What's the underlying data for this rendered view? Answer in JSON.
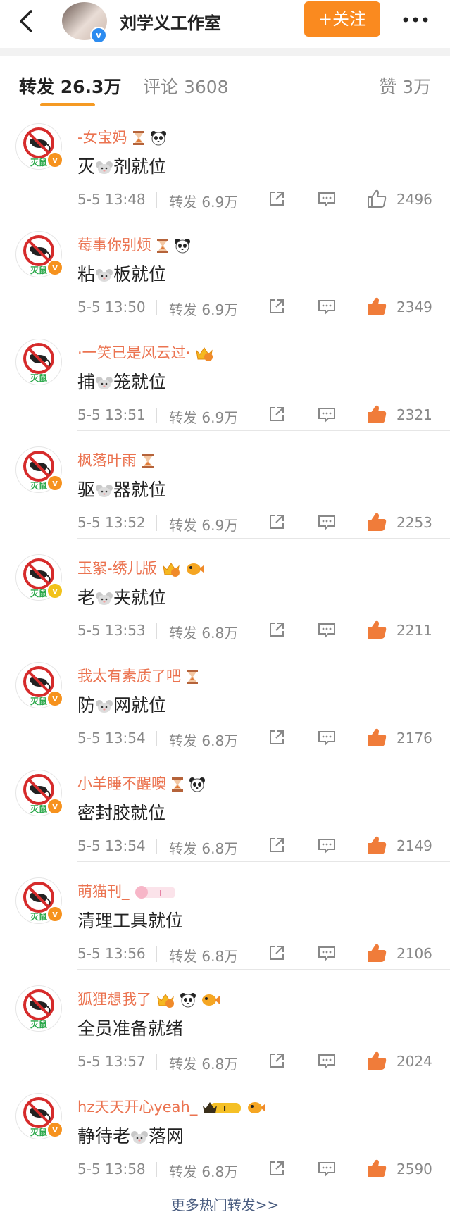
{
  "header": {
    "back_icon": "back-arrow-icon",
    "account_name": "刘学义工作室",
    "verified_badge": "v",
    "follow_label": "+关注",
    "more_icon": "more-dots-icon"
  },
  "tabs": {
    "forward": "转发 26.3万",
    "comment": "评论 3608",
    "like": "赞 3万"
  },
  "avatar_label": "灭鼠",
  "colors": {
    "accent": "#fa8a1f",
    "username": "#eb7350",
    "liked": "#f07c3a",
    "badge_orange": "#f6921e",
    "badge_gold": "#f2c21b"
  },
  "items": [
    {
      "name": "-女宝妈",
      "emojis": [
        "hourglass",
        "panda"
      ],
      "content_pre": "灭",
      "content_post": "剂就位",
      "has_mouse": true,
      "time": "5-5 13:48",
      "forward": "转发 6.9万",
      "likes": "2496",
      "liked": false,
      "badge": "orange"
    },
    {
      "name": "莓事你别烦",
      "emojis": [
        "hourglass",
        "panda"
      ],
      "content_pre": "粘",
      "content_post": "板就位",
      "has_mouse": true,
      "time": "5-5 13:50",
      "forward": "转发 6.9万",
      "likes": "2349",
      "liked": true,
      "badge": "orange"
    },
    {
      "name": "·一笑已是风云过·",
      "emojis": [
        "crown"
      ],
      "content_pre": "捕",
      "content_post": "笼就位",
      "has_mouse": true,
      "time": "5-5 13:51",
      "forward": "转发 6.9万",
      "likes": "2321",
      "liked": true,
      "badge": "none"
    },
    {
      "name": "枫落叶雨",
      "emojis": [
        "hourglass"
      ],
      "content_pre": "驱",
      "content_post": "器就位",
      "has_mouse": true,
      "time": "5-5 13:52",
      "forward": "转发 6.9万",
      "likes": "2253",
      "liked": true,
      "badge": "orange"
    },
    {
      "name": "玉絮-绣儿版",
      "emojis": [
        "crown",
        "fish"
      ],
      "content_pre": "老",
      "content_post": "夹就位",
      "has_mouse": true,
      "time": "5-5 13:53",
      "forward": "转发 6.8万",
      "likes": "2211",
      "liked": true,
      "badge": "gold"
    },
    {
      "name": "我太有素质了吧",
      "emojis": [
        "hourglass"
      ],
      "content_pre": "防",
      "content_post": "网就位",
      "has_mouse": true,
      "time": "5-5 13:54",
      "forward": "转发 6.8万",
      "likes": "2176",
      "liked": true,
      "badge": "orange"
    },
    {
      "name": "小羊睡不醒噢",
      "emojis": [
        "hourglass",
        "panda"
      ],
      "content_pre": "密封胶就位",
      "content_post": "",
      "has_mouse": false,
      "time": "5-5 13:54",
      "forward": "转发 6.8万",
      "likes": "2149",
      "liked": true,
      "badge": "orange"
    },
    {
      "name": "萌猫刊_",
      "emojis": [
        "pig-badge"
      ],
      "content_pre": "清理工具就位",
      "content_post": "",
      "has_mouse": false,
      "time": "5-5 13:56",
      "forward": "转发 6.8万",
      "likes": "2106",
      "liked": true,
      "badge": "orange"
    },
    {
      "name": "狐狸想我了",
      "emojis": [
        "crown",
        "panda",
        "fish"
      ],
      "content_pre": "全员准备就绪",
      "content_post": "",
      "has_mouse": false,
      "time": "5-5 13:57",
      "forward": "转发 6.8万",
      "likes": "2024",
      "liked": true,
      "badge": "none"
    },
    {
      "name": "hz天天开心yeah_",
      "emojis": [
        "crown-badge",
        "fish"
      ],
      "content_pre": "静待老",
      "content_post": "落网",
      "has_mouse": true,
      "time": "5-5 13:58",
      "forward": "转发 6.8万",
      "likes": "2590",
      "liked": true,
      "badge": "orange"
    }
  ],
  "footer": {
    "more_label": "更多热门转发>>"
  }
}
